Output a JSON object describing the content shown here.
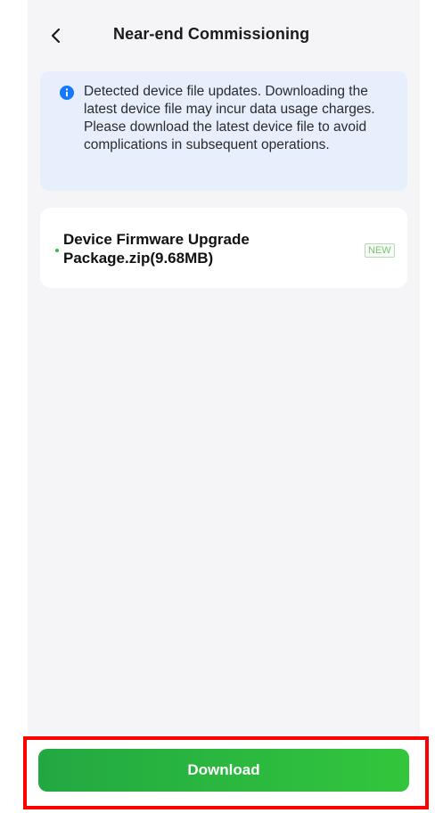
{
  "header": {
    "back_icon": "chevron-left-icon",
    "title": "Near-end Commissioning"
  },
  "notice": {
    "icon": "info-icon",
    "text": "Detected device file updates. Downloading the latest device file may incur data usage charges. Please download the latest device file to avoid complications in subsequent operations."
  },
  "file": {
    "name": "Device Firmware Upgrade Package.zip(9.68MB)",
    "badge": "NEW"
  },
  "footer": {
    "download_label": "Download"
  },
  "colors": {
    "accent": "#2fbe3f",
    "info": "#1677ff",
    "notice_bg": "#e6effb",
    "highlight": "#ff0000"
  }
}
